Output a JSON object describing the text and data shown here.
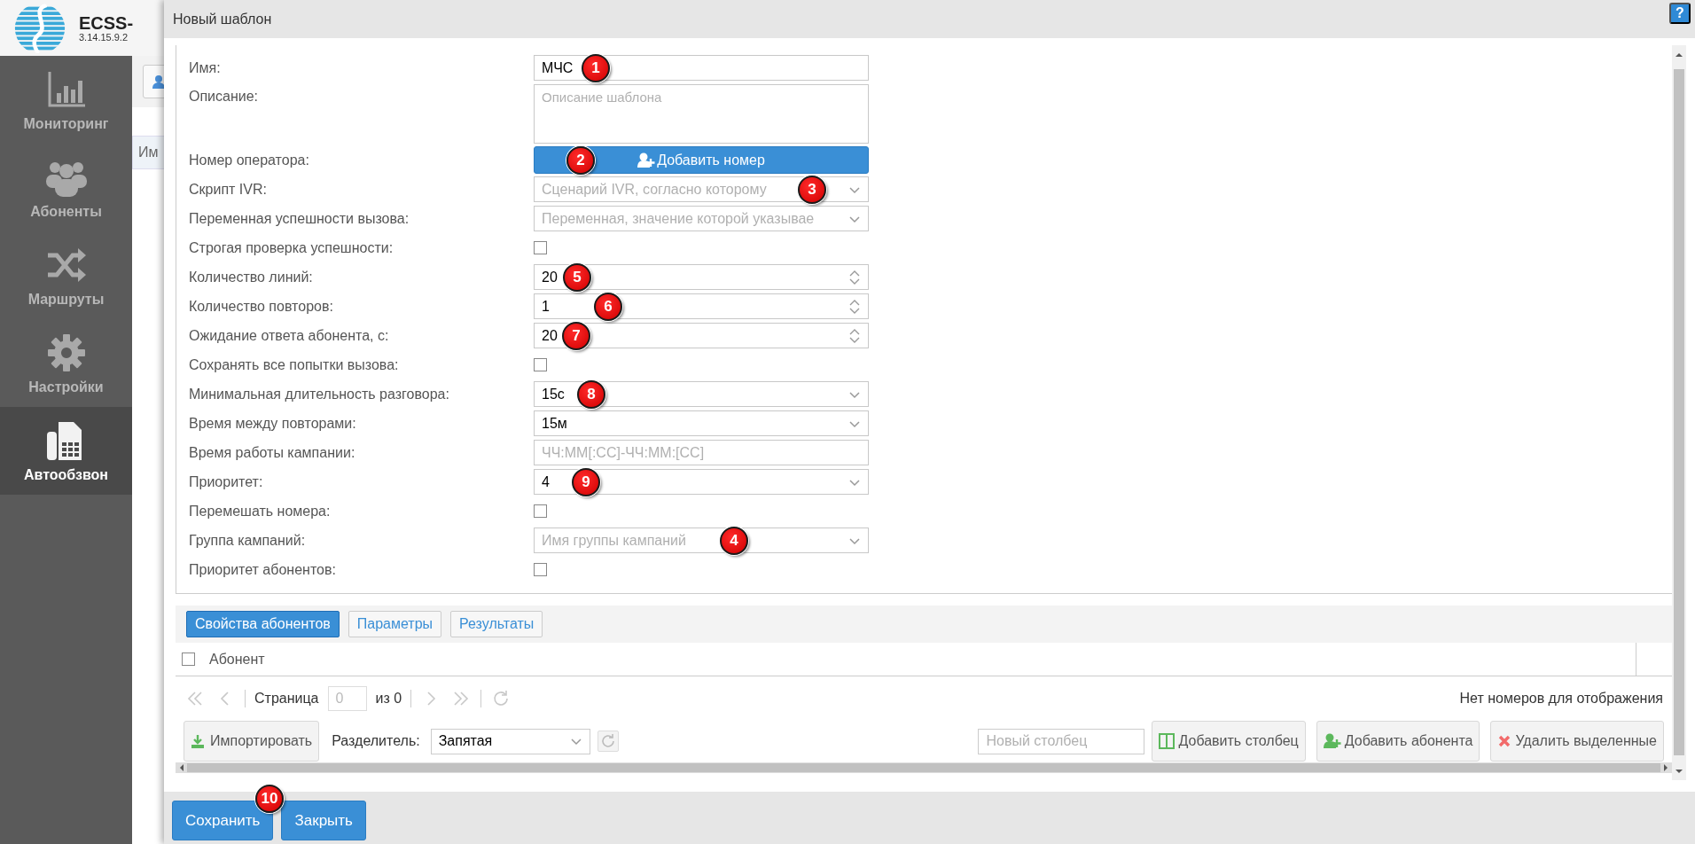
{
  "app": {
    "title": "ECSS-",
    "version": "3.14.15.9.2"
  },
  "sidebar": {
    "items": [
      {
        "label": "Мониторинг",
        "selected": false
      },
      {
        "label": "Абоненты",
        "selected": false
      },
      {
        "label": "Маршруты",
        "selected": false
      },
      {
        "label": "Настройки",
        "selected": false
      },
      {
        "label": "Автообзвон",
        "selected": true
      }
    ]
  },
  "background": {
    "column_header": "Им"
  },
  "dialog": {
    "title": "Новый шаблон",
    "help": "?",
    "form": {
      "rows": [
        {
          "label": "Имя:",
          "kind": "text",
          "value": "МЧС",
          "marker": "1"
        },
        {
          "label": "Описание:",
          "kind": "textarea",
          "placeholder": "Описание шаблона"
        },
        {
          "label": "Номер оператора:",
          "kind": "button",
          "text": "Добавить номер",
          "marker": "2"
        },
        {
          "label": "Скрипт IVR:",
          "kind": "select",
          "placeholder": "Сценарий IVR, согласно которому",
          "marker": "3"
        },
        {
          "label": "Переменная успешности вызова:",
          "kind": "select",
          "placeholder": "Переменная, значение которой указывае"
        },
        {
          "label": "Строгая проверка успешности:",
          "kind": "checkbox",
          "checked": false
        },
        {
          "label": "Количество линий:",
          "kind": "number",
          "value": "20",
          "marker": "5"
        },
        {
          "label": "Количество повторов:",
          "kind": "number",
          "value": "1",
          "marker": "6"
        },
        {
          "label": "Ожидание ответа абонента, с:",
          "kind": "number",
          "value": "20",
          "marker": "7"
        },
        {
          "label": "Сохранять все попытки вызова:",
          "kind": "checkbox",
          "checked": false
        },
        {
          "label": "Минимальная длительность разговора:",
          "kind": "select",
          "value": "15с",
          "marker": "8"
        },
        {
          "label": "Время между повторами:",
          "kind": "select",
          "value": "15м"
        },
        {
          "label": "Время работы кампании:",
          "kind": "text",
          "placeholder": "ЧЧ:ММ[:СС]-ЧЧ:ММ:[СС]"
        },
        {
          "label": "Приоритет:",
          "kind": "select",
          "value": "4",
          "marker": "9"
        },
        {
          "label": "Перемешать номера:",
          "kind": "checkbox",
          "checked": false
        },
        {
          "label": "Группа кампаний:",
          "kind": "select",
          "placeholder": "Имя группы кампаний",
          "marker": "4"
        },
        {
          "label": "Приоритет абонентов:",
          "kind": "checkbox",
          "checked": false
        }
      ]
    },
    "tabs": [
      {
        "label": "Свойства абонентов",
        "selected": true
      },
      {
        "label": "Параметры",
        "selected": false
      },
      {
        "label": "Результаты",
        "selected": false
      }
    ],
    "table": {
      "columns": [
        "Абонент"
      ],
      "select_all_checked": false
    },
    "pager": {
      "page_label": "Страница",
      "page": {
        "value": "0",
        "disabled": true
      },
      "of": "из 0",
      "status": "Нет номеров для отображения"
    },
    "toolbar": {
      "import": "Импортировать",
      "separator_label": "Разделитель:",
      "separator": "Запятая",
      "new_column_placeholder": "Новый столбец",
      "add_column": "Добавить столбец",
      "add_subscriber": "Добавить абонента",
      "delete_selected": "Удалить выделенные"
    },
    "buttons": [
      {
        "label": "Сохранить",
        "marker": "10"
      },
      {
        "label": "Закрыть"
      }
    ]
  }
}
